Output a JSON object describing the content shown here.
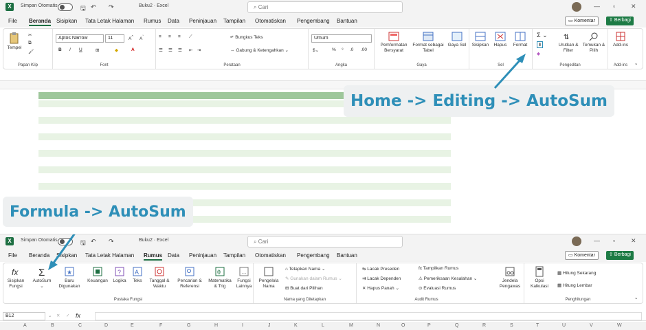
{
  "titlebar": {
    "autosave": "Simpan Otomatis",
    "filename": "Buku2 · Excel",
    "search": "Cari"
  },
  "menu": [
    "File",
    "Beranda",
    "Sisipkan",
    "Tata Letak Halaman",
    "Rumus",
    "Data",
    "Peninjauan",
    "Tampilan",
    "Otomatiskan",
    "Pengembang",
    "Bantuan"
  ],
  "top_active_tab": "Beranda",
  "bottom_active_tab": "Rumus",
  "buttons": {
    "comment": "Komentar",
    "share": "Berbagi"
  },
  "home_ribbon": {
    "clipboard": {
      "paste": "Tempel",
      "label": "Papan Klip"
    },
    "font": {
      "name": "Aptos Narrow",
      "size": "11",
      "label": "Font"
    },
    "alignment": {
      "wrap": "Bungkus Teks",
      "merge": "Gabung & Ketengahkan",
      "label": "Perataan"
    },
    "number": {
      "format": "Umum",
      "label": "Angka"
    },
    "styles": {
      "cond": "Pemformatan Bersyarat",
      "table": "Format sebagai Tabel",
      "cell": "Gaya Sel",
      "label": "Gaya"
    },
    "cells": {
      "insert": "Sisipkan",
      "delete": "Hapus",
      "format": "Format",
      "label": "Sel"
    },
    "editing": {
      "sort": "Urutkan & Filter",
      "find": "Temukan & Pilih",
      "label": "Pengeditan"
    },
    "addins": {
      "btn": "Add-ins",
      "label": "Add-ins"
    }
  },
  "formula_ribbon": {
    "library": {
      "insert": "Sisipkan Fungsi",
      "autosum": "AutoSum",
      "recent": "Baru Digunakan",
      "financial": "Keuangan",
      "logical": "Logika",
      "text": "Teks",
      "date": "Tanggal & Waktu",
      "lookup": "Pencarian & Referensi",
      "math": "Matematika & Trig",
      "more": "Fungsi Lainnya",
      "label": "Pustaka Fungsi"
    },
    "names": {
      "manager": "Pengelola Nama",
      "define": "Tetapkan Nama",
      "use": "Gunakan dalam Rumus",
      "create": "Buat dari Pilihan",
      "label": "Nama yang Ditetapkan"
    },
    "auditing": {
      "trace_prec": "Lacak Preseden",
      "trace_dep": "Lacak Dependen",
      "remove": "Hapus Panah",
      "show": "Tampilkan Rumus",
      "error": "Pemeriksaan Kesalahan",
      "evaluate": "Evaluasi Rumus",
      "watch": "Jendela Pengawas",
      "label": "Audit Rumus"
    },
    "calc": {
      "options": "Opsi Kalkulasi",
      "now": "Hitung Sekarang",
      "sheet": "Hitung Lembar",
      "label": "Penghitungan"
    }
  },
  "namebox": "B12",
  "fx": "fx",
  "columns": [
    "A",
    "B",
    "C",
    "D",
    "E",
    "F",
    "G",
    "H",
    "I",
    "J",
    "K",
    "L",
    "M",
    "N",
    "O",
    "P",
    "Q",
    "R",
    "S",
    "T",
    "U",
    "V",
    "W"
  ],
  "callouts": {
    "home": "Home -> Editing -> AutoSum",
    "formula": "Formula -> AutoSum"
  },
  "colors": {
    "accent": "#1d6f42",
    "callout": "#2e8fb8"
  }
}
